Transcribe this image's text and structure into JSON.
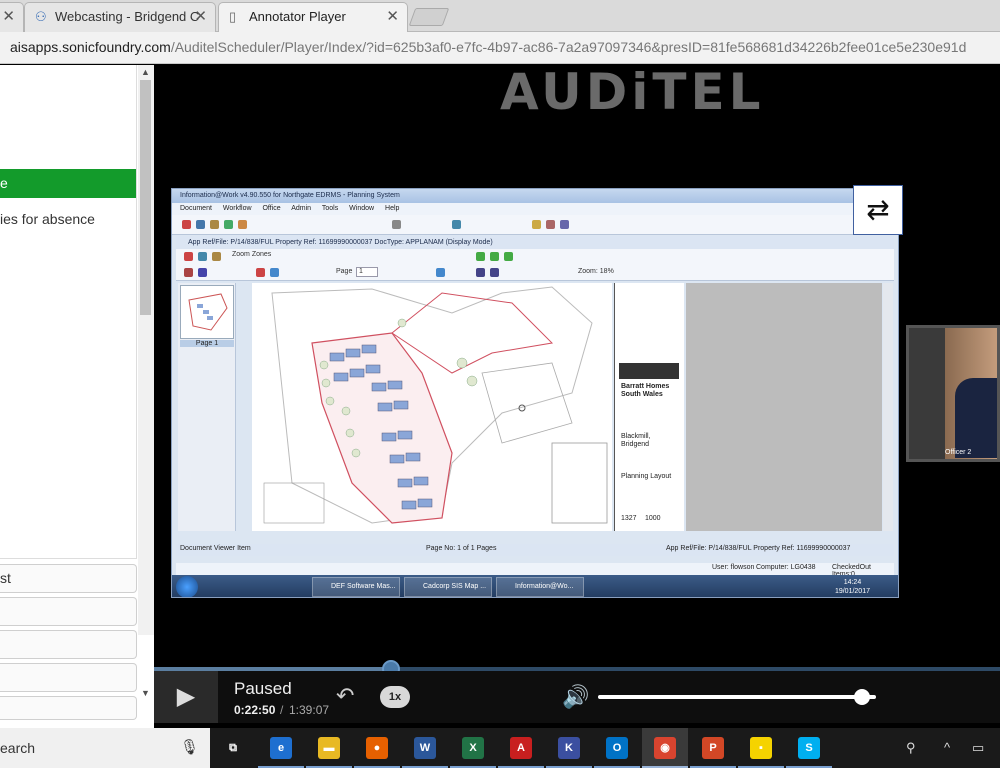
{
  "browser": {
    "tabs": [
      {
        "label": "",
        "close": "✕"
      },
      {
        "label": "Webcasting - Bridgend C",
        "close": "✕"
      },
      {
        "label": "Annotator Player",
        "close": "✕"
      }
    ],
    "url_host": "aisapps.sonicfoundry.com",
    "url_path": "/AuditelScheduler/Player/Index/?id=625b3af0-e7fc-4b97-ac86-7a2a97097346&presID=81fe568681d34226b2fee01ce5e230e91d"
  },
  "sidebar": {
    "active_item": "e",
    "next_item": "ies for absence",
    "buttons": [
      "st",
      "",
      "",
      "",
      ""
    ]
  },
  "player": {
    "logo": "AUDiTEL",
    "switch_icon": "⇄",
    "state": "Paused",
    "current_time": "0:22:50",
    "time_separator": "/",
    "total_time": "1:39:07",
    "progress": 0.28,
    "speed": "1x",
    "volume": 0.95,
    "webcam_caption": "Officer 2"
  },
  "slide": {
    "app_title": "Information@Work v4.90.550 for Northgate EDRMS - Planning System",
    "menu": [
      "Document",
      "Workflow",
      "Office",
      "Admin",
      "Tools",
      "Window",
      "Help"
    ],
    "doc_title": "App Ref/File: P/14/838/FUL  Property Ref: 11699990000037   DocType: APPLANAM (Display Mode)",
    "zoom_zones": "Zoom Zones",
    "page_label": "Page",
    "page_value": "1",
    "zoom": "Zoom: 18%",
    "thumb_label": "Page 1",
    "titleblock": [
      "Barratt Homes",
      "South Wales",
      "Blackmill,",
      "Bridgend",
      "Planning Layout",
      "1327",
      "1000"
    ],
    "status_left": "Document Viewer Item",
    "status_center": "Page No: 1 of 1 Pages",
    "status_right": "App Ref/File: P/14/838/FUL  Property Ref: 11699990000037",
    "user": "User: flowson",
    "computer": "Computer: LG0438",
    "checked_out": "CheckedOut Items:0",
    "taskbar_items": [
      "DEF Software Mas...",
      "Cadcorp SIS Map ...",
      "Information@Wo..."
    ],
    "clock_time": "14:24",
    "clock_date": "19/01/2017"
  },
  "taskbar": {
    "search_text": "earch",
    "apps": [
      {
        "name": "task-view",
        "glyph": "⧉",
        "color": "#1a1a1a"
      },
      {
        "name": "edge",
        "glyph": "e",
        "color": "#1e6fd0"
      },
      {
        "name": "file-explorer",
        "glyph": "▬",
        "color": "#e8b923"
      },
      {
        "name": "firefox",
        "glyph": "●",
        "color": "#e66000"
      },
      {
        "name": "word",
        "glyph": "W",
        "color": "#2b579a"
      },
      {
        "name": "excel",
        "glyph": "X",
        "color": "#217346"
      },
      {
        "name": "acrobat",
        "glyph": "A",
        "color": "#c81f1f"
      },
      {
        "name": "keepass",
        "glyph": "K",
        "color": "#3b4fa0"
      },
      {
        "name": "outlook",
        "glyph": "O",
        "color": "#0072c6"
      },
      {
        "name": "chrome",
        "glyph": "◉",
        "color": "#d9442f"
      },
      {
        "name": "powerpoint",
        "glyph": "P",
        "color": "#d24726"
      },
      {
        "name": "sticky-notes",
        "glyph": "▪",
        "color": "#f5d300"
      },
      {
        "name": "skype",
        "glyph": "S",
        "color": "#00aff0"
      }
    ]
  },
  "colors": {
    "agenda_active": "#139b2b",
    "progress": "#4a7aa8"
  }
}
